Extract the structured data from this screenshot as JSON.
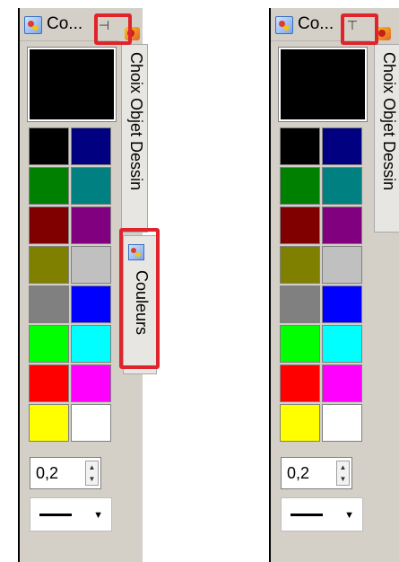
{
  "panels": [
    {
      "title": "Co...",
      "pin_icon": "pin-horizontal-icon",
      "line_width": "0,2",
      "tabs": [
        "Choix Objet Dessin",
        "Couleurs"
      ]
    },
    {
      "title": "Co...",
      "pin_icon": "pin-vertical-icon",
      "line_width": "0,2",
      "tabs": [
        "Choix Objet Dessin"
      ]
    }
  ],
  "preview_color": "#000000",
  "palette": [
    "#000000",
    "#000080",
    "#008000",
    "#008080",
    "#800000",
    "#800080",
    "#808000",
    "#c0c0c0",
    "#808080",
    "#0000ff",
    "#00ff00",
    "#00ffff",
    "#ff0000",
    "#ff00ff",
    "#ffff00",
    "#ffffff"
  ],
  "highlight_color": "#e0242b"
}
